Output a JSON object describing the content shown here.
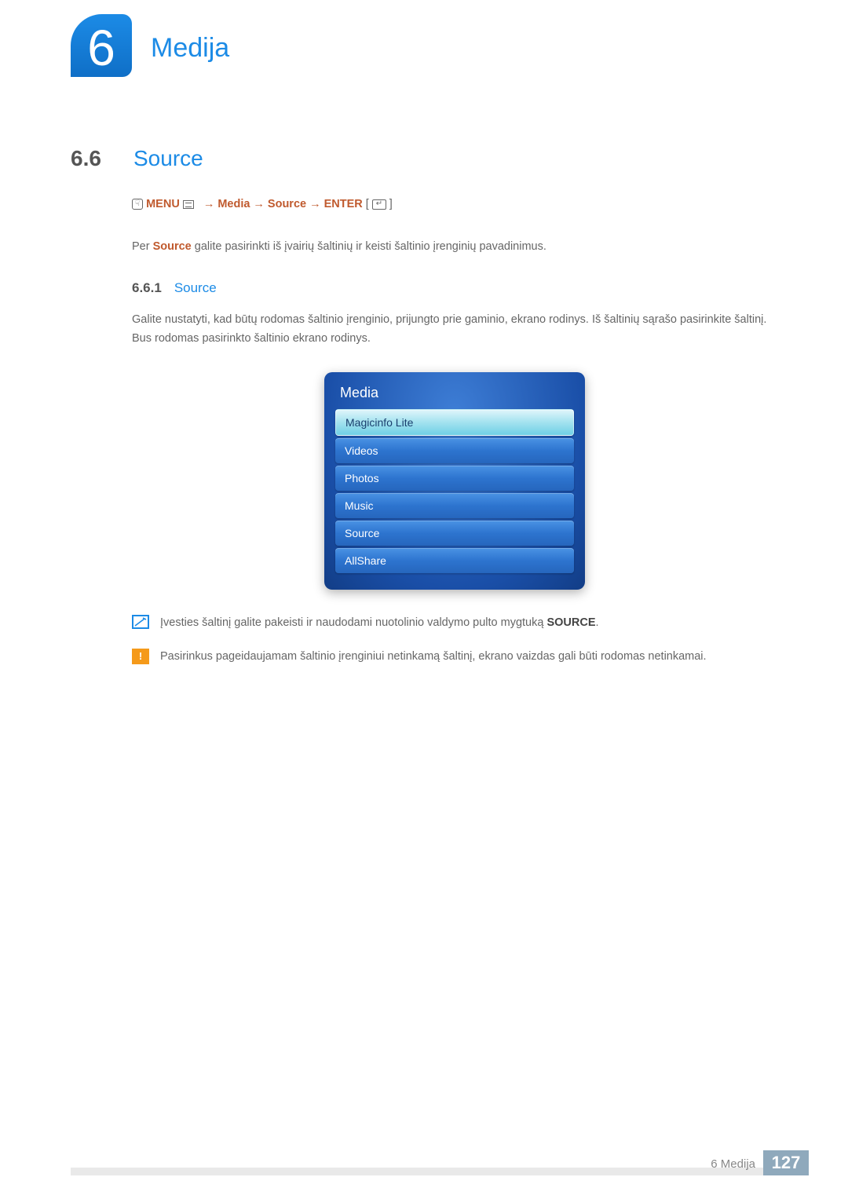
{
  "chapter": {
    "number": "6",
    "title": "Medija"
  },
  "section": {
    "number": "6.6",
    "title": "Source"
  },
  "nav": {
    "menu_label": "MENU",
    "arrow": "→",
    "step1": "Media",
    "step2": "Source",
    "enter_label": "ENTER"
  },
  "intro_pre": "Per ",
  "intro_bold": "Source",
  "intro_post": " galite pasirinkti iš įvairių šaltinių ir keisti šaltinio įrenginių pavadinimus.",
  "subsection": {
    "number": "6.6.1",
    "title": "Source"
  },
  "sub_para": "Galite nustatyti, kad būtų rodomas šaltinio įrenginio, prijungto prie gaminio, ekrano rodinys. Iš šaltinių sąrašo pasirinkite šaltinį. Bus rodomas pasirinkto šaltinio ekrano rodinys.",
  "menu_panel": {
    "title": "Media",
    "items": [
      {
        "label": "Magicinfo Lite",
        "selected": true
      },
      {
        "label": "Videos",
        "selected": false
      },
      {
        "label": "Photos",
        "selected": false
      },
      {
        "label": "Music",
        "selected": false
      },
      {
        "label": "Source",
        "selected": false
      },
      {
        "label": "AllShare",
        "selected": false
      }
    ]
  },
  "note1_pre": "Įvesties šaltinį galite pakeisti ir naudodami nuotolinio valdymo pulto mygtuką ",
  "note1_bold": "SOURCE",
  "note1_post": ".",
  "note2": "Pasirinkus pageidaujamam šaltinio įrenginiui netinkamą šaltinį, ekrano vaizdas gali būti rodomas netinkamai.",
  "footer": {
    "label": "6 Medija",
    "page": "127"
  }
}
